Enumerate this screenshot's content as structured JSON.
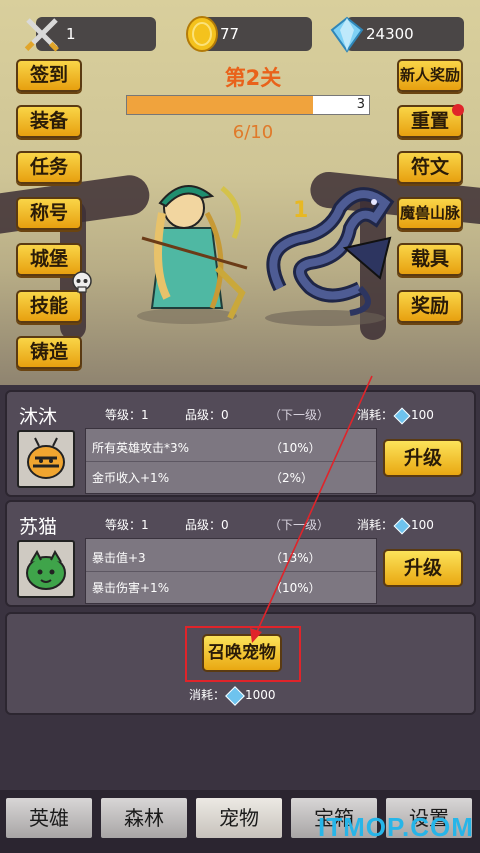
{
  "top": {
    "sword_value": "1",
    "coin_value": "77",
    "gem_value": "24300"
  },
  "left_menu": [
    "签到",
    "装备",
    "任务",
    "称号",
    "城堡",
    "技能",
    "铸造"
  ],
  "right_menu": [
    "新人奖励",
    "重置",
    "符文",
    "魔兽山脉",
    "载具",
    "奖励"
  ],
  "stage": {
    "title": "第2关",
    "progress_value": "3",
    "progress_ratio": 0.77,
    "wave": "6/10",
    "damage_number": "1"
  },
  "pets": [
    {
      "name": "沐沐",
      "level_label": "等级：1",
      "grade_label": "品级：0",
      "next_label": "（下一级）",
      "cost_label": "消耗：",
      "cost_value": "100",
      "stats": [
        {
          "text": "所有英雄攻击*3%",
          "pct": "（10%）"
        },
        {
          "text": "金币收入+1%",
          "pct": "（2%）"
        }
      ],
      "upgrade_label": "升级"
    },
    {
      "name": "苏猫",
      "level_label": "等级：1",
      "grade_label": "品级：0",
      "next_label": "（下一级）",
      "cost_label": "消耗：",
      "cost_value": "100",
      "stats": [
        {
          "text": "暴击值+3",
          "pct": "（13%）"
        },
        {
          "text": "暴击伤害+1%",
          "pct": "（10%）"
        }
      ],
      "upgrade_label": "升级"
    }
  ],
  "summon": {
    "button_label": "召唤宠物",
    "cost_label": "消耗：",
    "cost_value": "1000"
  },
  "tabs": [
    "英雄",
    "森林",
    "宠物",
    "宝箱",
    "设置"
  ],
  "watermark": "ITMOP.COM",
  "colors": {
    "accent_gold": "#f2c230",
    "annotation_red": "#e0242a",
    "progress_fill": "#f0a33d",
    "panel": "#534b58"
  }
}
